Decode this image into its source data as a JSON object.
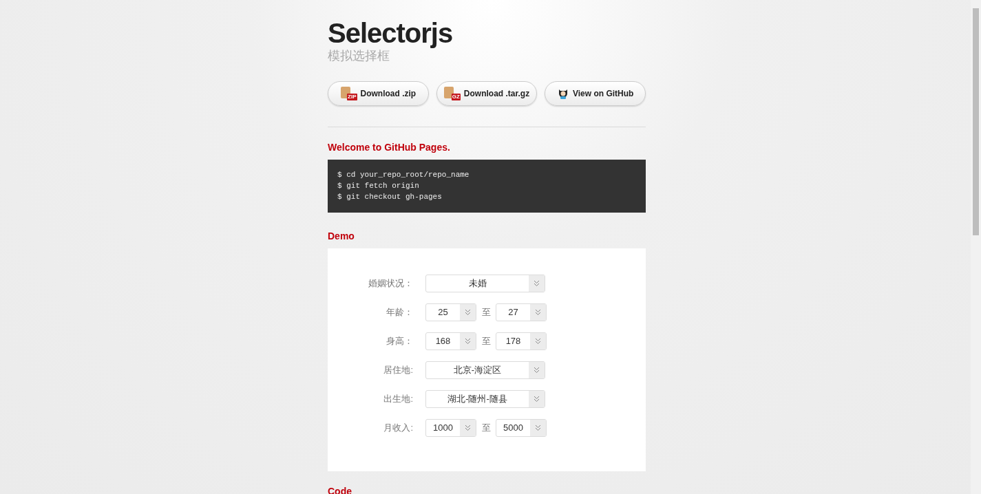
{
  "header": {
    "title": "Selectorjs",
    "subtitle": "模拟选择框"
  },
  "buttons": [
    {
      "label": "Download .zip",
      "kind": "zip",
      "badge": "ZIP"
    },
    {
      "label": "Download .tar.gz",
      "kind": "tar",
      "badge": "GZ"
    },
    {
      "label": "View on GitHub",
      "kind": "github"
    }
  ],
  "welcome": {
    "heading": "Welcome to GitHub Pages.",
    "code_lines": [
      "$ cd your_repo_root/repo_name",
      "$ git fetch origin",
      "$ git checkout gh-pages"
    ]
  },
  "demo": {
    "heading": "Demo",
    "rows": [
      {
        "label": "婚姻状况：",
        "kind": "single",
        "value": "未婚"
      },
      {
        "label": "年龄：",
        "kind": "range",
        "from": "25",
        "separator": "至",
        "to": "27"
      },
      {
        "label": "身高：",
        "kind": "range",
        "from": "168",
        "separator": "至",
        "to": "178"
      },
      {
        "label": "居住地:",
        "kind": "single",
        "value": "北京-海淀区"
      },
      {
        "label": "出生地:",
        "kind": "single",
        "value": "湖北-随州-随县"
      },
      {
        "label": "月收入:",
        "kind": "range",
        "from": "1000",
        "separator": "至",
        "to": "5000"
      }
    ]
  },
  "code": {
    "heading": "Code"
  }
}
